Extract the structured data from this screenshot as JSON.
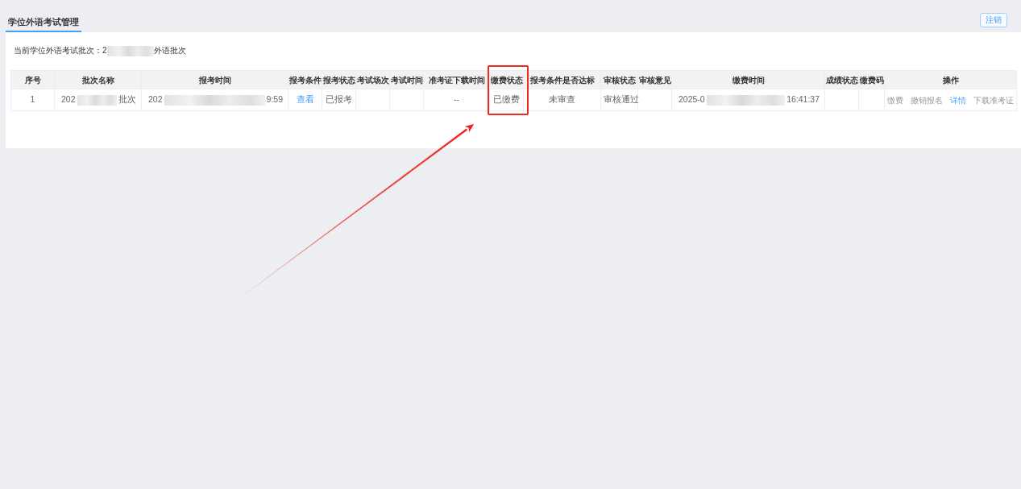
{
  "tabs": [
    {
      "label": "学位外语考试管理",
      "selected": true
    }
  ],
  "logout_button": "注销",
  "batch": {
    "label": "当前学位外语考试批次：",
    "value": {
      "start": "2",
      "end": "外语批次"
    }
  },
  "table": {
    "columns": [
      {
        "label": "序号",
        "highlighted": false
      },
      {
        "label": "批次名称",
        "highlighted": false
      },
      {
        "label": "报考时间",
        "highlighted": false
      },
      {
        "label": "报考条件",
        "highlighted": false
      },
      {
        "label": "报考状态",
        "highlighted": false
      },
      {
        "label": "考试场次",
        "highlighted": false
      },
      {
        "label": "考试时间",
        "highlighted": false
      },
      {
        "label": "准考证下载时间",
        "highlighted": false
      },
      {
        "label": "缴费状态",
        "highlighted": true
      },
      {
        "label": "报考条件是否达标",
        "highlighted": false
      },
      {
        "label": "审核状态",
        "highlighted": false
      },
      {
        "label": "审核意见",
        "highlighted": false
      },
      {
        "label": "缴费时间",
        "highlighted": false
      },
      {
        "label": "成绩状态",
        "highlighted": false
      },
      {
        "label": "缴费码",
        "highlighted": false
      },
      {
        "label": "操作",
        "highlighted": false
      }
    ],
    "rows": [
      {
        "cells": [
          {
            "kind": "text",
            "text": "1"
          },
          {
            "kind": "redacted",
            "start": "202",
            "end": "批次"
          },
          {
            "kind": "redacted",
            "start": "202",
            "end": "9:59"
          },
          {
            "kind": "link",
            "text": "查看"
          },
          {
            "kind": "text",
            "text": "已报考"
          },
          {
            "kind": "empty"
          },
          {
            "kind": "empty"
          },
          {
            "kind": "text",
            "text": "--"
          },
          {
            "kind": "text",
            "text": "已缴费"
          },
          {
            "kind": "text",
            "text": "未审查"
          },
          {
            "kind": "text",
            "text": "审核通过"
          },
          {
            "kind": "empty"
          },
          {
            "kind": "redacted",
            "start": "2025-0",
            "end": "16:41:37"
          },
          {
            "kind": "empty"
          },
          {
            "kind": "empty"
          },
          {
            "kind": "actions",
            "actions": [
              {
                "label": "缴费",
                "disabled": true
              },
              {
                "label": "撤销报名",
                "disabled": true
              },
              {
                "label": "详情",
                "disabled": false
              },
              {
                "label": "下载准考证",
                "disabled": true
              }
            ]
          }
        ]
      }
    ]
  }
}
